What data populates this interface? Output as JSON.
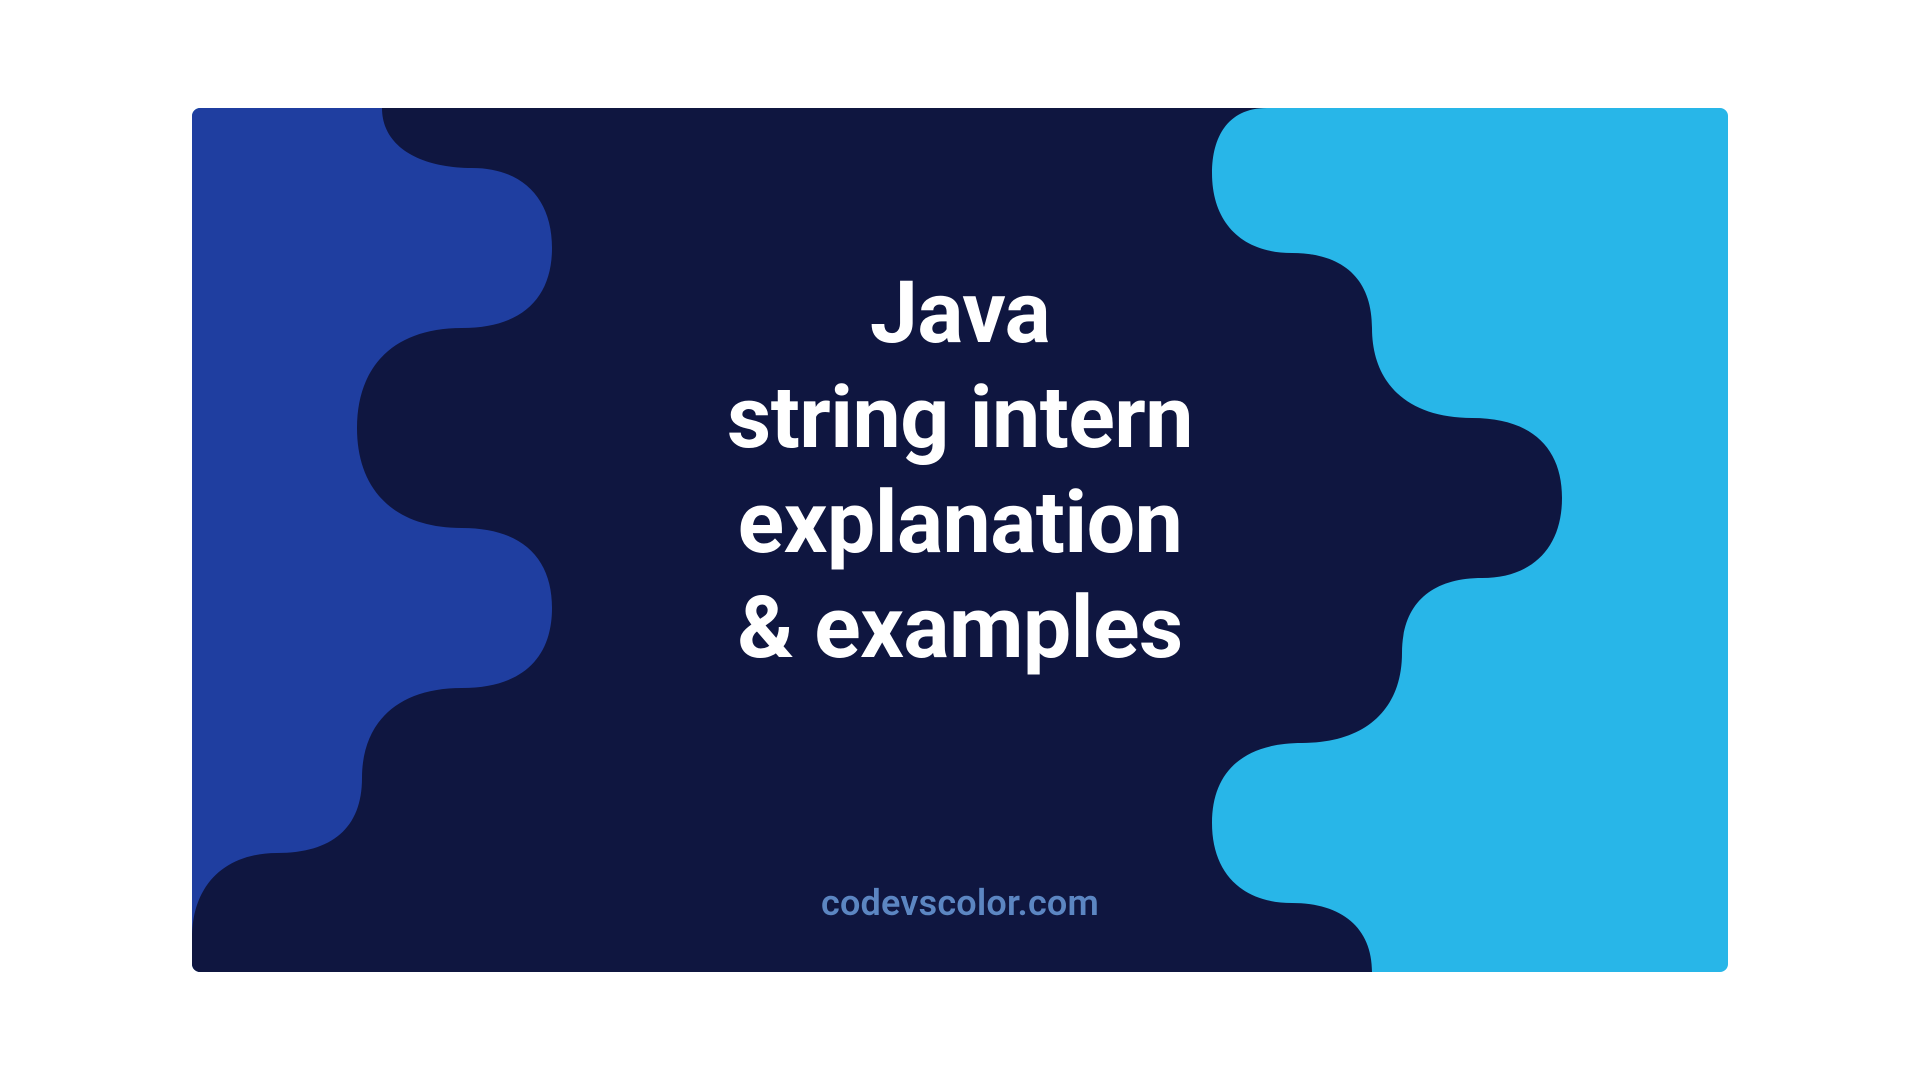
{
  "title": {
    "line1": "Java",
    "line2": "string intern",
    "line3": "explanation",
    "line4": "& examples"
  },
  "footer": "codevscolor.com",
  "colors": {
    "bg_right": "#28b6e8",
    "bg_left": "#1f3ea0",
    "blob": "#0f1640",
    "text": "#ffffff",
    "footer_text": "#5c86c2"
  }
}
